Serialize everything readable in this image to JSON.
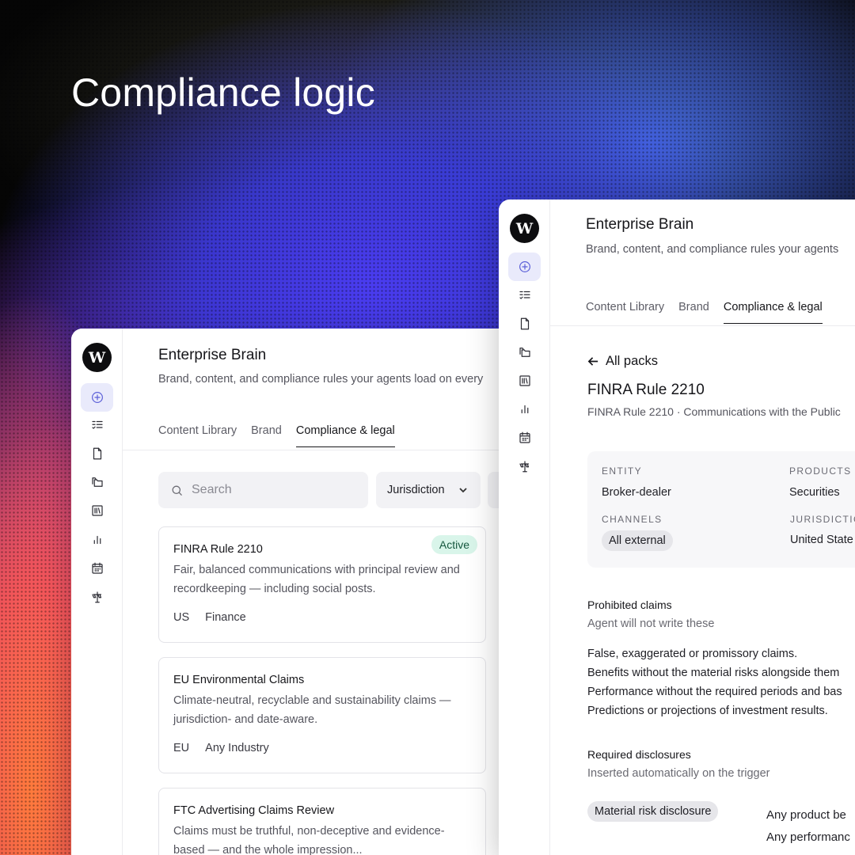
{
  "headline": "Compliance logic",
  "left_panel": {
    "logo_letter": "W",
    "brand_title": "Enterprise Brain",
    "brand_subtitle": "Brand, content, and compliance rules your agents load on every",
    "tabs": [
      {
        "label": "Content Library",
        "active": false
      },
      {
        "label": "Brand",
        "active": false
      },
      {
        "label": "Compliance & legal",
        "active": true
      }
    ],
    "search": {
      "placeholder": "Search",
      "value": ""
    },
    "filter": {
      "label": "Jurisdiction"
    },
    "cards": [
      {
        "title": "FINRA Rule 2210",
        "description": "Fair, balanced communications with principal review and recordkeeping — including social posts.",
        "status": "Active",
        "region": "US",
        "industry": "Finance"
      },
      {
        "title": "EU Environmental Claims",
        "description": "Climate-neutral, recyclable and sustainability claims — jurisdiction- and date-aware.",
        "status": "",
        "region": "EU",
        "industry": "Any Industry"
      },
      {
        "title": "FTC Advertising Claims Review",
        "description": "Claims must be truthful, non-deceptive and evidence-based — and the whole impression...",
        "status": "",
        "region": "",
        "industry": ""
      }
    ]
  },
  "right_panel": {
    "logo_letter": "W",
    "brand_title": "Enterprise Brain",
    "brand_subtitle": "Brand, content, and compliance rules your agents",
    "tabs": [
      {
        "label": "Content Library",
        "active": false
      },
      {
        "label": "Brand",
        "active": false
      },
      {
        "label": "Compliance & legal",
        "active": true
      }
    ],
    "back_label": "All packs",
    "rule_title": "FINRA Rule 2210",
    "rule_subtitle": "FINRA Rule 2210 · Communications with the Public",
    "meta": {
      "entity_label": "ENTITY",
      "entity_value": "Broker-dealer",
      "products_label": "PRODUCTS",
      "products_value": "Securities",
      "channels_label": "CHANNELS",
      "channels_value": "All external",
      "jurisdiction_label": "JURISDICTIC",
      "jurisdiction_value": "United State"
    },
    "prohibited": {
      "title": "Prohibited claims",
      "subtitle": "Agent will not write these",
      "items": [
        "False, exaggerated or promissory claims.",
        "Benefits without the material risks alongside them",
        "Performance without the required periods and bas",
        "Predictions or projections of investment results."
      ]
    },
    "disclosures": {
      "title": "Required disclosures",
      "subtitle": "Inserted automatically on the trigger",
      "chip": "Material risk disclosure",
      "triggers": [
        "Any product be",
        "Any performanc"
      ]
    }
  },
  "rail_icons": [
    "plus-circle-icon",
    "checklist-icon",
    "document-icon",
    "folders-icon",
    "library-icon",
    "bar-chart-icon",
    "calendar-icon",
    "signpost-icon"
  ]
}
